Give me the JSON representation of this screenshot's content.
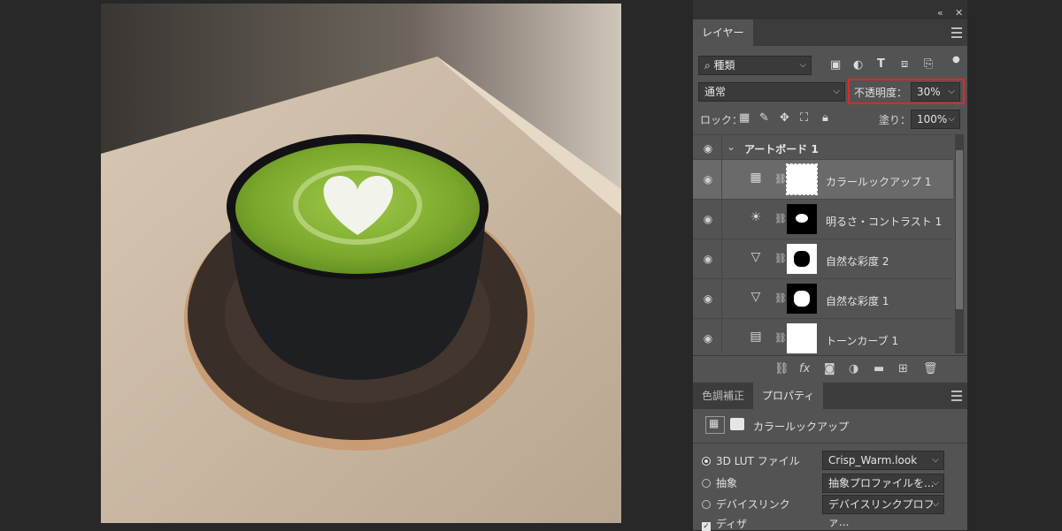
{
  "panel": {
    "collapse_icon": "double-chevron-icon",
    "close_icon": "close-icon",
    "layers_tab_label": "レイヤー",
    "filter": {
      "placeholder_label": "種類"
    },
    "blend_mode": "通常",
    "opacity_label": "不透明度：",
    "opacity_value": "30%",
    "lock_label": "ロック：",
    "fill_label": "塗り：",
    "fill_value": "100%",
    "layers": [
      {
        "name": "アートボード 1",
        "type": "artboard-group"
      },
      {
        "name": "カラールックアップ 1",
        "type": "color-lookup",
        "mask": "white",
        "selected": true
      },
      {
        "name": "明るさ・コントラスト 1",
        "type": "brightness-contrast",
        "mask": "black-with-white-blob"
      },
      {
        "name": "自然な彩度 2",
        "type": "vibrance",
        "mask": "white-with-black-blob"
      },
      {
        "name": "自然な彩度 1",
        "type": "vibrance",
        "mask": "black-with-white-blob"
      },
      {
        "name": "トーンカーブ 1",
        "type": "curves",
        "mask": "white"
      }
    ]
  },
  "properties": {
    "tab_adjustments_label": "色調補正",
    "tab_properties_label": "プロパティ",
    "title": "カラールックアップ",
    "option_3dlut_label": "3D LUT ファイル",
    "option_3dlut_value": "Crisp_Warm.look",
    "option_abstract_label": "抽象",
    "option_abstract_value": "抽象プロファイルを...",
    "option_devicelink_label": "デバイスリンク",
    "option_devicelink_value": "デバイスリンクプロファ...",
    "dither_label": "ディザ"
  },
  "colors": {
    "highlight": "#e0262a",
    "panel_bg": "#535353",
    "app_bg": "#282828"
  }
}
